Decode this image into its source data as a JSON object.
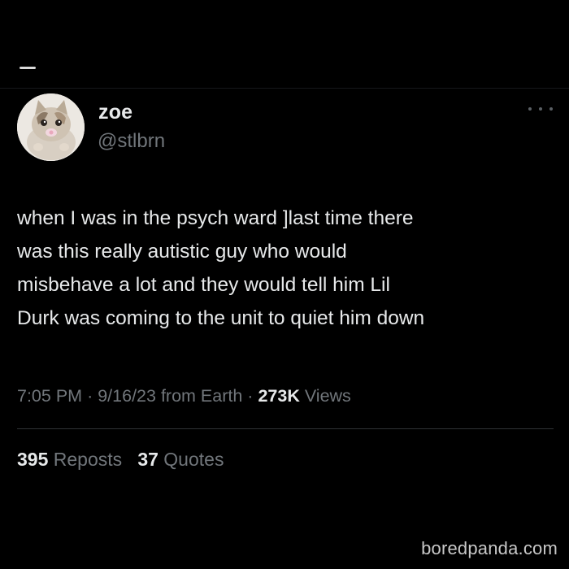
{
  "author": {
    "display_name": "zoe",
    "handle": "@stlbrn"
  },
  "tweet": {
    "lines": [
      "when I was in the psych ward ]last time there",
      "was this really autistic guy who would",
      "misbehave a lot and they would tell him Lil",
      "Durk was coming to the unit to quiet him down"
    ]
  },
  "meta": {
    "time": "7:05 PM",
    "date": "9/16/23",
    "source": "from Earth",
    "views_count": "273K",
    "views_label": "Views",
    "separator": "·"
  },
  "stats": {
    "reposts_count": "395",
    "reposts_label": "Reposts",
    "quotes_count": "37",
    "quotes_label": "Quotes"
  },
  "watermark": "boredpanda.com",
  "colors": {
    "background": "#000000",
    "primary_text": "#e7e9ea",
    "secondary_text": "#71767b",
    "divider": "#2f3336"
  },
  "icons": {
    "more": "more-horizontal-icon",
    "avatar": "kitten-avatar"
  }
}
